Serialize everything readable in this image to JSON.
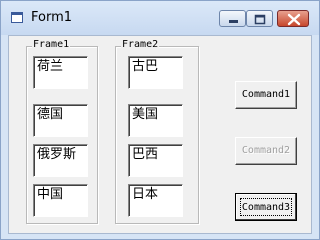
{
  "window": {
    "title": "Form1",
    "icon": "vb-form-icon",
    "controls": [
      "minimize-icon",
      "maximize-icon",
      "close-icon"
    ]
  },
  "frame1": {
    "label": "Frame1",
    "textboxes": [
      "荷兰",
      "德国",
      "俄罗斯",
      "中国"
    ]
  },
  "frame2": {
    "label": "Frame2",
    "textboxes": [
      "古巴",
      "美国",
      "巴西",
      "日本"
    ]
  },
  "buttons": {
    "command1": "Command1",
    "command2": "Command2",
    "command3": "Command3"
  },
  "state": {
    "command2_enabled": false,
    "focused_button": "Command3"
  }
}
